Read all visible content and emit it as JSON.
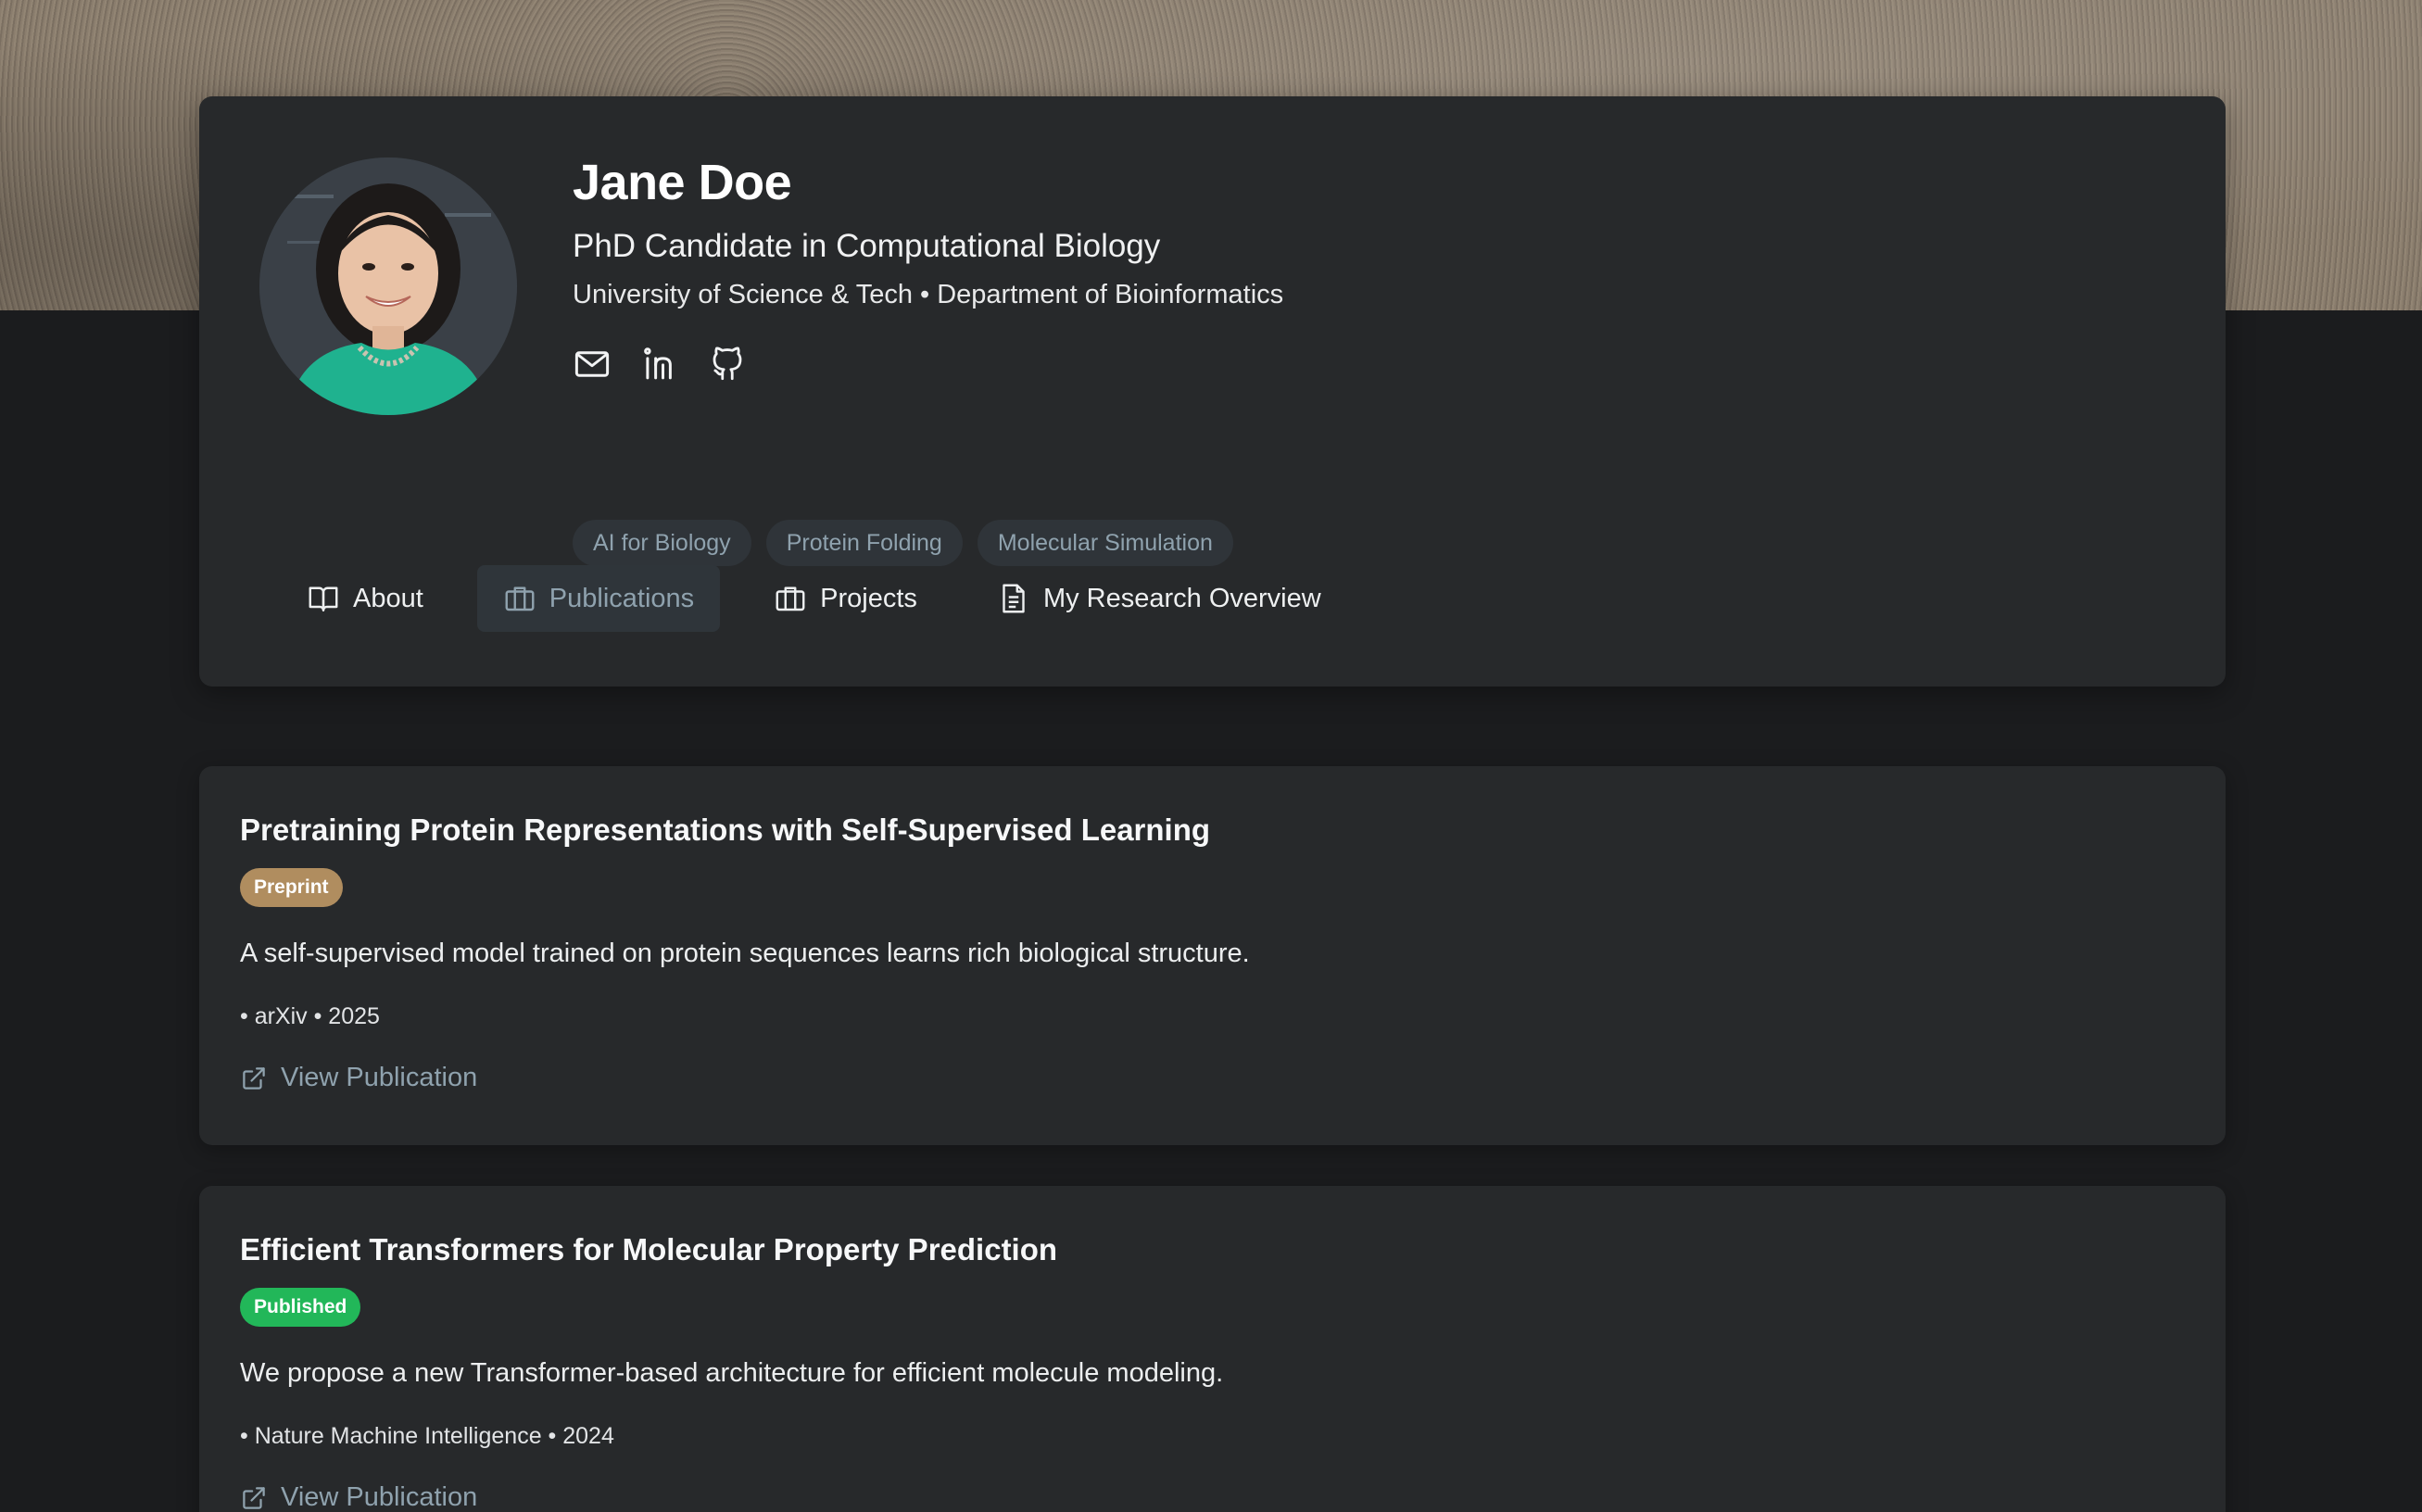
{
  "profile": {
    "name": "Jane Doe",
    "title": "PhD Candidate in Computational Biology",
    "affiliation": "University of Science & Tech • Department of Bioinformatics",
    "socials": [
      {
        "icon": "mail-icon"
      },
      {
        "icon": "linkedin-icon"
      },
      {
        "icon": "github-icon"
      }
    ],
    "tags": [
      "AI for Biology",
      "Protein Folding",
      "Molecular Simulation"
    ]
  },
  "tabs": [
    {
      "label": "About",
      "icon": "book-icon",
      "active": false
    },
    {
      "label": "Publications",
      "icon": "briefcase-icon",
      "active": true
    },
    {
      "label": "Projects",
      "icon": "briefcase-icon",
      "active": false
    },
    {
      "label": "My Research Overview",
      "icon": "document-icon",
      "active": false
    }
  ],
  "publications": [
    {
      "title": "Pretraining Protein Representations with Self-Supervised Learning",
      "status": "Preprint",
      "description": "A self-supervised model trained on protein sequences learns rich biological structure.",
      "meta": "• arXiv • 2025",
      "link_label": "View Publication"
    },
    {
      "title": "Efficient Transformers for Molecular Property Prediction",
      "status": "Published",
      "description": "We propose a new Transformer-based architecture for efficient molecule modeling.",
      "meta": "• Nature Machine Intelligence • 2024",
      "link_label": "View Publication"
    }
  ],
  "colors": {
    "accent": "#8fa2ae",
    "preprint": "#b08d5f",
    "published": "#22b759",
    "card": "#27292b",
    "background": "#1b1c1e"
  }
}
